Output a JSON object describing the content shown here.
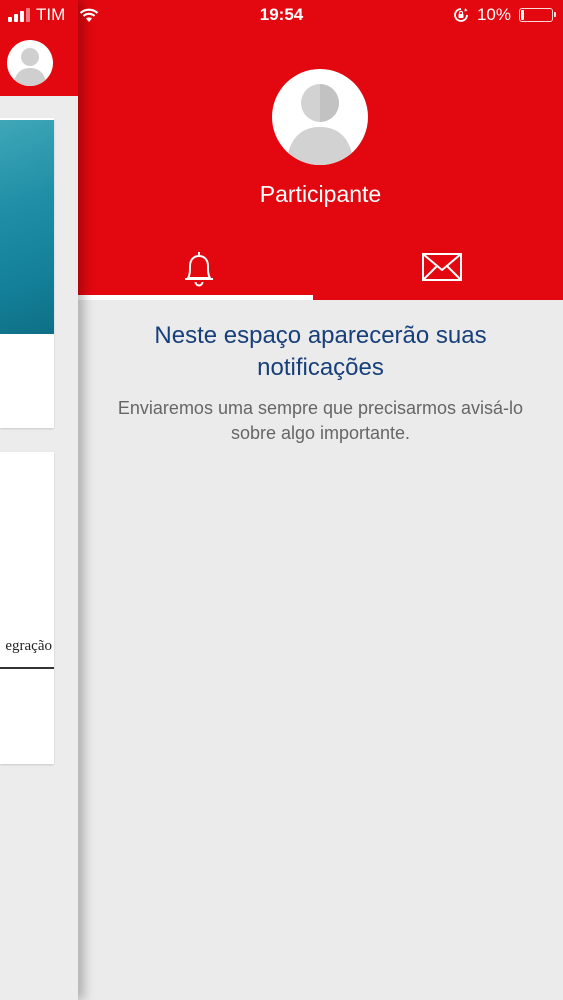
{
  "status_bar": {
    "carrier": "TIM",
    "time": "19:54",
    "battery_percent": "10%",
    "battery_level": 0.1,
    "icons": [
      "signal-icon",
      "wifi-icon",
      "orientation-lock-icon",
      "battery-icon"
    ]
  },
  "background_app": {
    "card_text": "egração"
  },
  "drawer": {
    "profile_name": "Participante",
    "tabs": [
      {
        "icon": "bell-icon",
        "selected": true
      },
      {
        "icon": "mail-icon",
        "selected": false
      }
    ],
    "empty_title": "Neste espaço aparecerão suas notificações",
    "empty_description": "Enviaremos uma sempre que precisarmos avisá-lo sobre algo importante."
  },
  "colors": {
    "brand_red": "#e3080f",
    "title_blue": "#173f7a",
    "text_gray": "#666666",
    "background": "#ebebeb"
  }
}
